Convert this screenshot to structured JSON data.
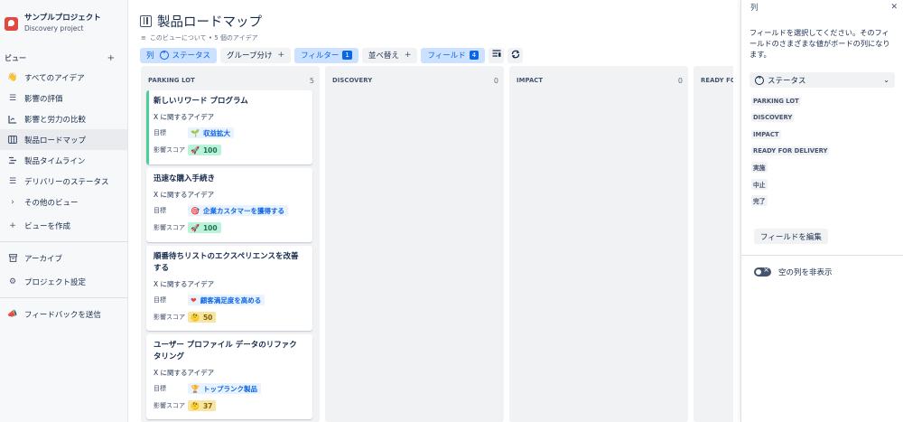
{
  "project": {
    "name": "サンプルプロジェクト",
    "subtitle": "Discovery project"
  },
  "sidebar": {
    "section_title": "ビュー",
    "add_icon": "plus-icon",
    "items": [
      {
        "label": "すべてのアイデア",
        "icon": "hand-wave-icon"
      },
      {
        "label": "影響の評価",
        "icon": "list-icon"
      },
      {
        "label": "影響と労力の比較",
        "icon": "chart-icon"
      },
      {
        "label": "製品ロードマップ",
        "icon": "board-icon",
        "active": true
      },
      {
        "label": "製品タイムライン",
        "icon": "timeline-icon"
      },
      {
        "label": "デリバリーのステータス",
        "icon": "list-icon"
      },
      {
        "label": "その他のビュー",
        "icon": "chevron-right-icon"
      },
      {
        "label": "ビューを作成",
        "icon": "plus-icon"
      }
    ],
    "bottom_items": [
      {
        "label": "アーカイブ",
        "icon": "archive-icon"
      },
      {
        "label": "プロジェクト設定",
        "icon": "gear-icon"
      }
    ],
    "feedback": {
      "label": "フィードバックを送信",
      "icon": "megaphone-icon"
    }
  },
  "header": {
    "title": "製品ロードマップ",
    "meta": "このビューについて • 5 個のアイデア"
  },
  "toolbar": {
    "columns_label": "列",
    "columns_value": "ステータス",
    "group_label": "グループ分け",
    "filter_label": "フィルター",
    "filter_count": "1",
    "sort_label": "並べ替え",
    "fields_label": "フィールド",
    "fields_count": "4"
  },
  "columns": [
    {
      "name": "PARKING LOT",
      "count": "5"
    },
    {
      "name": "DISCOVERY",
      "count": "0"
    },
    {
      "name": "IMPACT",
      "count": "0"
    },
    {
      "name": "READY FOR DE"
    }
  ],
  "cards": [
    {
      "title": "新しいリワード プログラム",
      "line": "X に関するアイデア",
      "goal_label": "目標",
      "goal": "収益拡大",
      "goal_emoji": "🌱",
      "score_label": "影響スコア",
      "score": "100",
      "score_emoji": "🚀",
      "score_color": "green"
    },
    {
      "title": "迅速な購入手続き",
      "line": "X に関するアイデア",
      "goal_label": "目標",
      "goal": "企業カスタマーを獲得する",
      "goal_emoji": "🎯",
      "score_label": "影響スコア",
      "score": "100",
      "score_emoji": "🚀",
      "score_color": "green"
    },
    {
      "title": "順番待ちリストのエクスペリエンスを改善する",
      "line": "X に関するアイデア",
      "goal_label": "目標",
      "goal": "顧客満足度を高める",
      "goal_emoji": "❤",
      "score_label": "影響スコア",
      "score": "50",
      "score_emoji": "🤔",
      "score_color": "yellow"
    },
    {
      "title": "ユーザー プロファイル データのリファクタリング",
      "line": "X に関するアイデア",
      "goal_label": "目標",
      "goal": "トップランク製品",
      "goal_emoji": "🏆",
      "score_label": "影響スコア",
      "score": "37",
      "score_emoji": "🤔",
      "score_color": "yellow"
    }
  ],
  "panel": {
    "title": "列",
    "description": "フィールドを選択してください。そのフィールドのさまざまな値がボードの列になります。",
    "select_value": "ステータス",
    "options": [
      "PARKING LOT",
      "DISCOVERY",
      "IMPACT",
      "READY FOR DELIVERY",
      "実施",
      "中止",
      "完了"
    ],
    "edit_button": "フィールドを編集",
    "toggle_label": "空の列を非表示"
  }
}
